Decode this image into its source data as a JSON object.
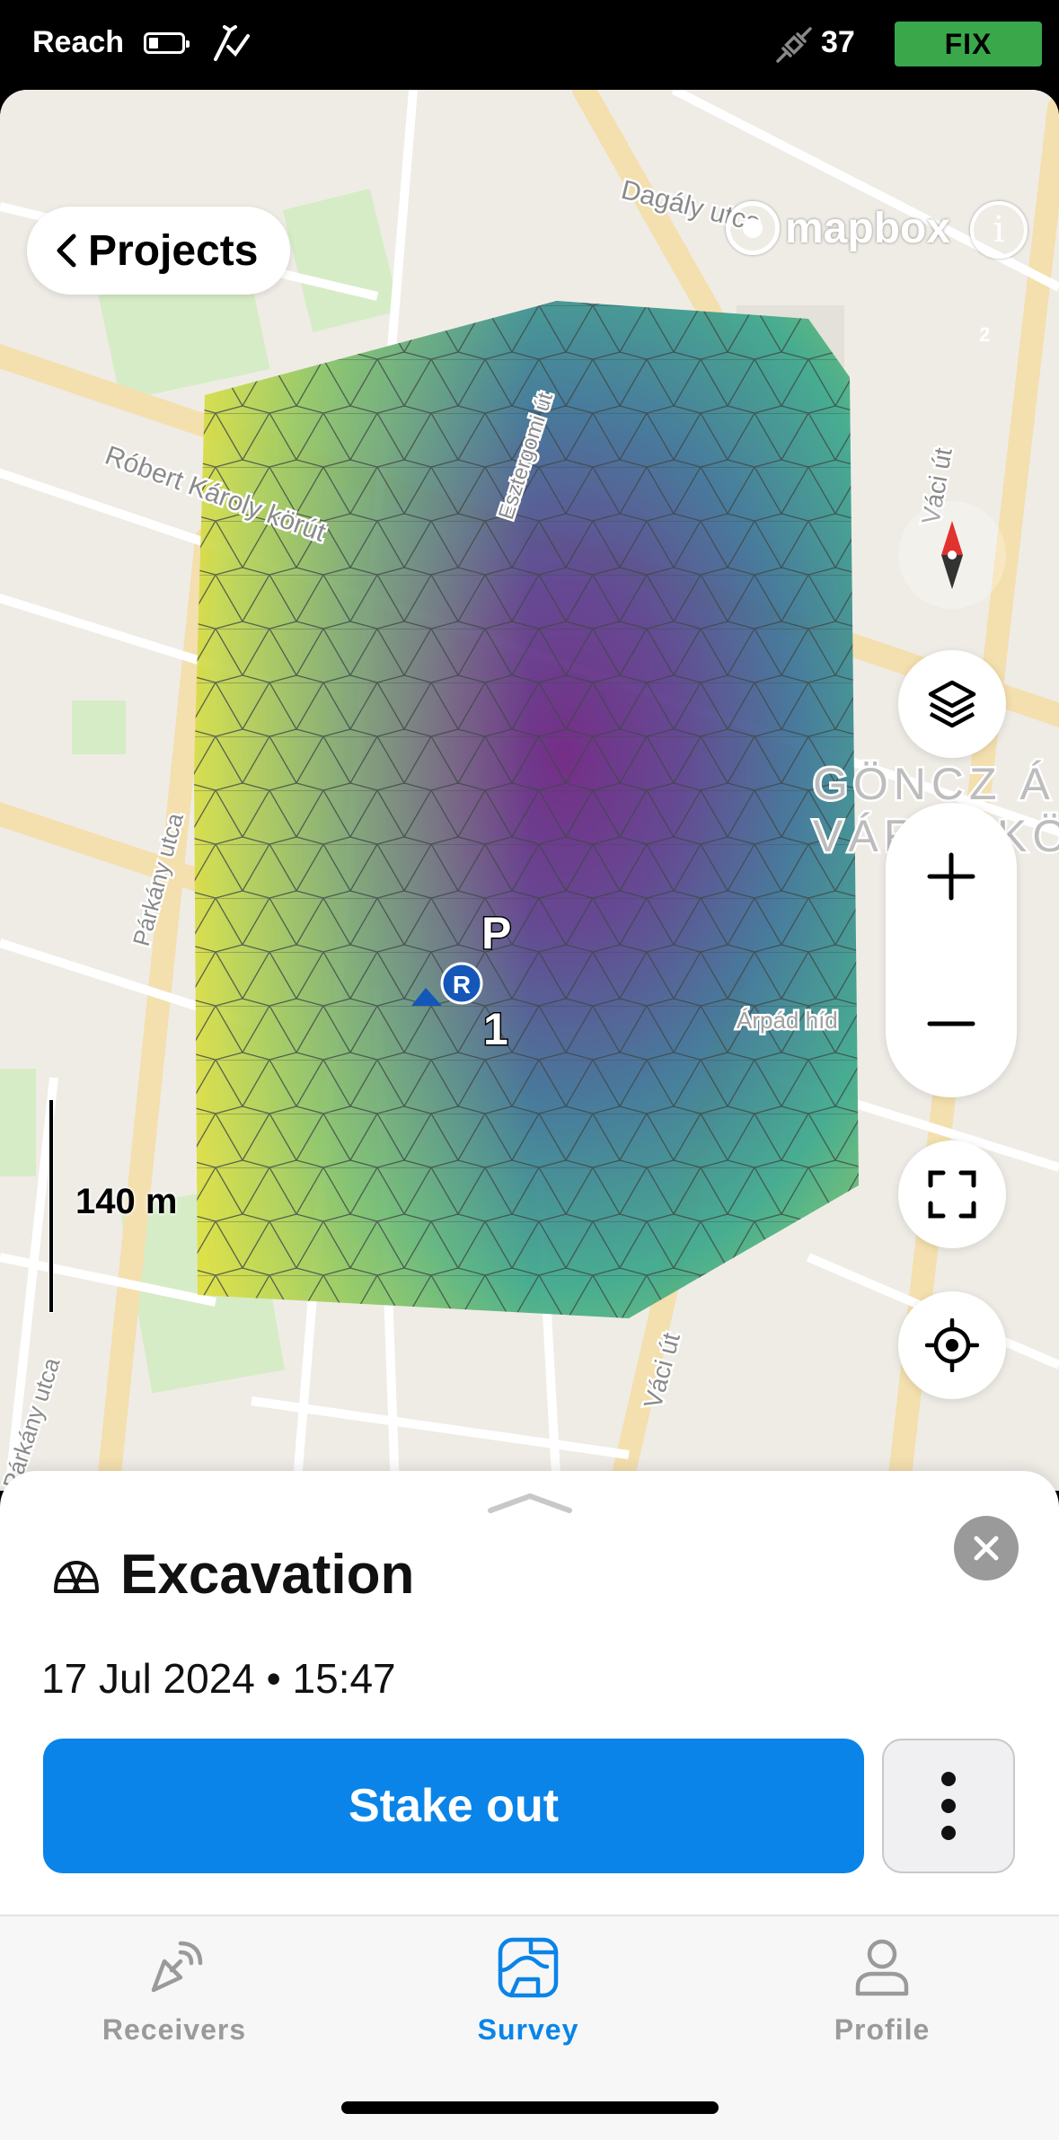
{
  "status_bar": {
    "app_name": "Reach",
    "satellite_count": "37",
    "fix_status": "FIX",
    "fix_color": "#3aa84a"
  },
  "map": {
    "back_button_label": "Projects",
    "attribution": "mapbox",
    "scale_label": "140 m",
    "street_labels": [
      "Dagály utca",
      "Róbert Károly körút",
      "Esztergomi út",
      "Párkány utca",
      "Váci út",
      "Váci út",
      "Párkány utca",
      "GÖNCZ Á",
      "VÁROSKÖZ",
      "Árpád híd"
    ],
    "point_labels": {
      "point_p": "P",
      "point_1": "1",
      "rover": "R"
    },
    "road_number": "2",
    "icons": [
      "compass-icon",
      "layers-icon",
      "plus-icon",
      "minus-icon",
      "fit-bounds-icon",
      "crosshair-icon",
      "info-icon"
    ]
  },
  "sheet": {
    "title": "Excavation",
    "date": "17 Jul 2024 • 15:47",
    "primary_action": "Stake out",
    "accent_color": "#0a84e8"
  },
  "tabs": [
    {
      "label": "Receivers",
      "icon": "receiver-icon",
      "active": false
    },
    {
      "label": "Survey",
      "icon": "survey-icon",
      "active": true
    },
    {
      "label": "Profile",
      "icon": "profile-icon",
      "active": false
    }
  ]
}
